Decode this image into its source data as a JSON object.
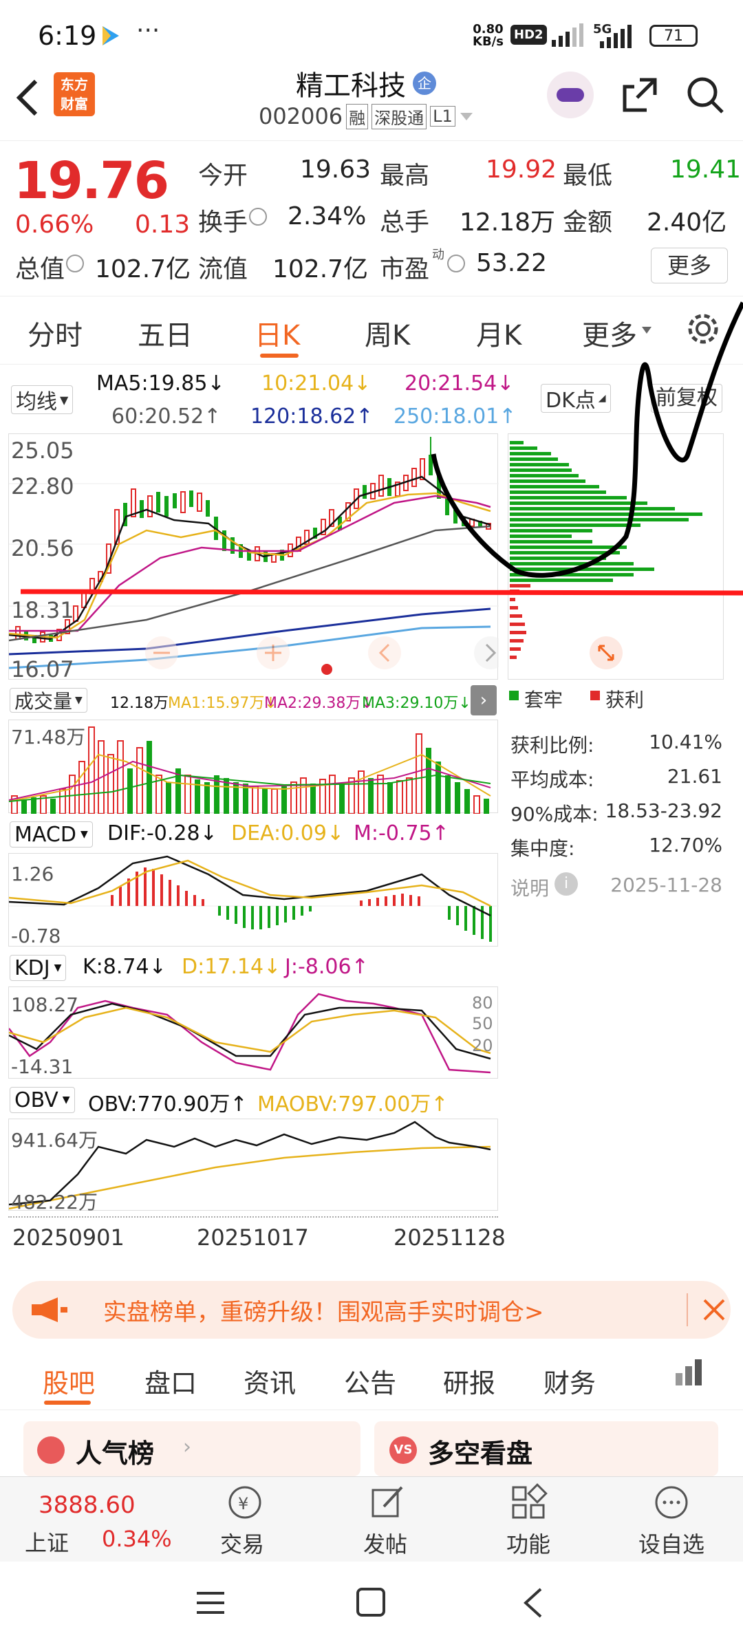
{
  "status": {
    "time": "6:19",
    "more": "···",
    "speed_top": "0.80",
    "speed_bottom": "KB/s",
    "hd": "HD2",
    "net": "5G",
    "battery": "71"
  },
  "header": {
    "logo_line1": "东方",
    "logo_line2": "财富",
    "stock_name": "精工科技",
    "company_badge": "企",
    "code": "002006",
    "tags": [
      "融",
      "深股通",
      "L1"
    ]
  },
  "quote": {
    "price": "19.76",
    "pct": "0.66%",
    "chg": "0.13",
    "fields": {
      "open_label": "今开",
      "open": "19.63",
      "high_label": "最高",
      "high": "19.92",
      "low_label": "最低",
      "low": "19.41",
      "turnover_label": "换手",
      "turnover": "2.34%",
      "volume_label": "总手",
      "volume": "12.18万",
      "amount_label": "金额",
      "amount": "2.40亿",
      "mcap_label": "总值",
      "mcap": "102.7亿",
      "float_label": "流值",
      "float": "102.7亿",
      "pe_label": "市盈",
      "pe_sup": "动",
      "pe": "53.22"
    },
    "more_btn": "更多"
  },
  "period_tabs": {
    "items": [
      "分时",
      "五日",
      "日K",
      "周K",
      "月K"
    ],
    "more": "更多",
    "active": "日K"
  },
  "ma": {
    "selector": "均线",
    "ma5": "MA5:19.85↓",
    "ma10": "10:21.04↓",
    "ma20": "20:21.54↓",
    "ma60": "60:20.52↑",
    "ma120": "120:18.62↑",
    "ma250": "250:18.01↑",
    "dk": "DK点",
    "fq": "前复权"
  },
  "price_axis": [
    "25.05",
    "22.80",
    "20.56",
    "18.31",
    "16.07"
  ],
  "vol": {
    "selector": "成交量",
    "v": "12.18万",
    "ma1": "MA1:15.97万↓",
    "ma2": "MA2:29.38万↓",
    "ma3": "MA3:29.10万↓",
    "axis": "71.48万"
  },
  "macd": {
    "selector": "MACD",
    "dif": "DIF:-0.28↓",
    "dea": "DEA:0.09↓",
    "m": "M:-0.75↑",
    "top": "1.26",
    "bottom": "-0.78"
  },
  "kdj": {
    "selector": "KDJ",
    "k": "K:8.74↓",
    "d": "D:17.14↓",
    "j": "J:-8.06↑",
    "top": "108.27",
    "bottom": "-14.31",
    "levels": [
      "80",
      "50",
      "20"
    ]
  },
  "obv": {
    "selector": "OBV",
    "obv": "OBV:770.90万↑",
    "maobv": "MAOBV:797.00万↑",
    "top": "941.64万",
    "bottom": "482.22万"
  },
  "dates": [
    "20250901",
    "20251017",
    "20251128"
  ],
  "chip": {
    "legend_trap": "套牢",
    "legend_profit": "获利",
    "rows": [
      [
        "获利比例:",
        "10.41%"
      ],
      [
        "平均成本:",
        "21.61"
      ],
      [
        "90%成本:",
        "18.53-23.92"
      ],
      [
        "集中度:",
        "12.70%"
      ]
    ],
    "note_label": "说明",
    "note_date": "2025-11-28"
  },
  "banner": {
    "text": "实盘榜单，重磅升级！围观高手实时调仓>"
  },
  "content_tabs": {
    "items": [
      "股吧",
      "盘口",
      "资讯",
      "公告",
      "研报",
      "财务"
    ],
    "active": "股吧"
  },
  "cards": {
    "left": "人气榜",
    "right": "多空看盘"
  },
  "footer": {
    "index_value": "3888.60",
    "index_name": "上证",
    "index_pct": "0.34%",
    "trade": "交易",
    "post": "发帖",
    "func": "功能",
    "watch": "设自选"
  },
  "colors": {
    "up": "#e12b2b",
    "down": "#12a319",
    "accent": "#f26622",
    "ma5": "#111111",
    "ma10": "#e6b21a",
    "ma20": "#c01686",
    "ma60": "#555555",
    "ma120": "#1a2e9a",
    "ma250": "#58a6e0"
  }
}
